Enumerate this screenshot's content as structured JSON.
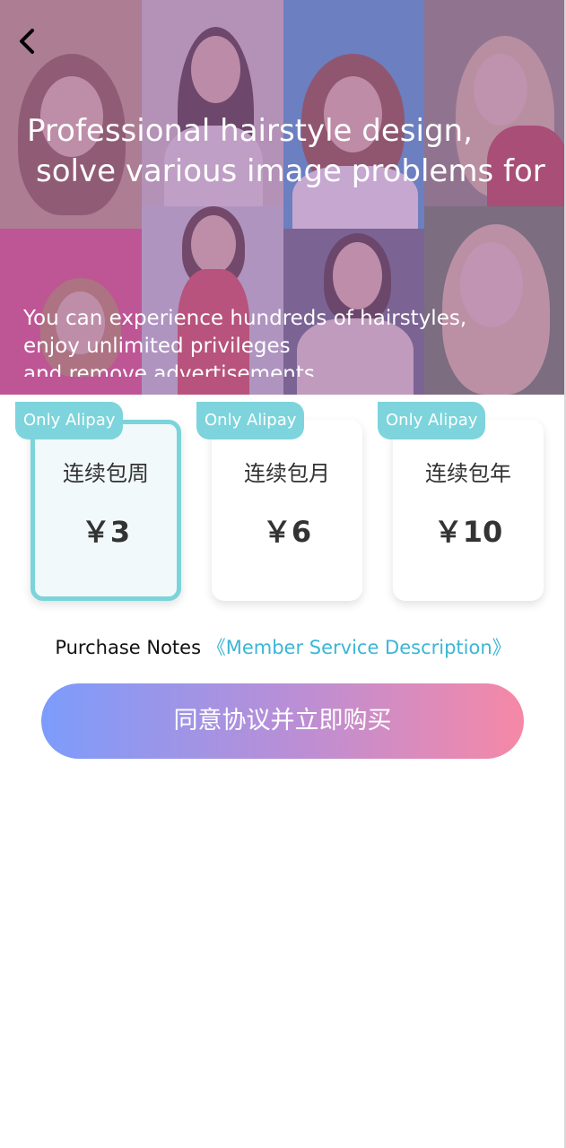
{
  "hero": {
    "title_line1": "Professional hairstyle design,",
    "title_line2": "solve various image problems for",
    "subtitle_line1": "You can experience hundreds of hairstyles,",
    "subtitle_line2": "enjoy unlimited privileges",
    "subtitle_line3": "and remove advertisements",
    "back_icon": "chevron-left-icon"
  },
  "plans": [
    {
      "badge": "Only Alipay",
      "name": "连续包周",
      "price": "￥3",
      "selected": true
    },
    {
      "badge": "Only Alipay",
      "name": "连续包月",
      "price": "￥6",
      "selected": false
    },
    {
      "badge": "Only Alipay",
      "name": "连续包年",
      "price": "￥10",
      "selected": false
    }
  ],
  "notes": {
    "label": "Purchase Notes",
    "link": "《Member Service Description》"
  },
  "buy_button": {
    "label": "同意协议并立即购买"
  },
  "colors": {
    "accent": "#7dd4dc",
    "link": "#3bb6d6",
    "gradient_start": "#7c9cfb",
    "gradient_end": "#f688a6",
    "hero_overlay": "#965faa"
  }
}
